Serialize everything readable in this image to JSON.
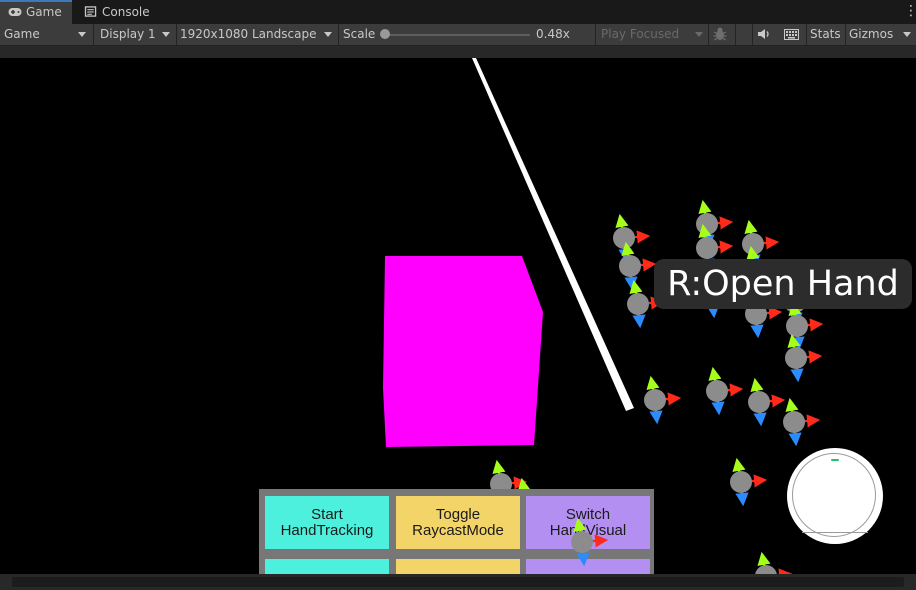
{
  "tabs": [
    {
      "label": "Game",
      "icon": "gamepad-icon",
      "active": true
    },
    {
      "label": "Console",
      "icon": "console-icon",
      "active": false
    }
  ],
  "toolbar": {
    "view_mode": "Game",
    "display": "Display 1",
    "resolution": "1920x1080 Landscape",
    "scale_label": "Scale",
    "scale_value": "0.48x",
    "play_mode": "Play Focused",
    "stats": "Stats",
    "gizmos": "Gizmos"
  },
  "scene": {
    "hand_label": "R:Open Hand",
    "cube_color": "#ff00ff",
    "menu_buttons": [
      {
        "label": "Start\nHandTracking",
        "color": "cyan"
      },
      {
        "label": "Toggle\nRaycastMode",
        "color": "yellow"
      },
      {
        "label": "Switch\nHandVisual",
        "color": "purple"
      }
    ]
  },
  "colors": {
    "accent": "#3a79bb",
    "axis_x": "#ff2a1a",
    "axis_y": "#a6ff1a",
    "axis_z": "#2a8cff",
    "joint": "#8c8c8c"
  }
}
